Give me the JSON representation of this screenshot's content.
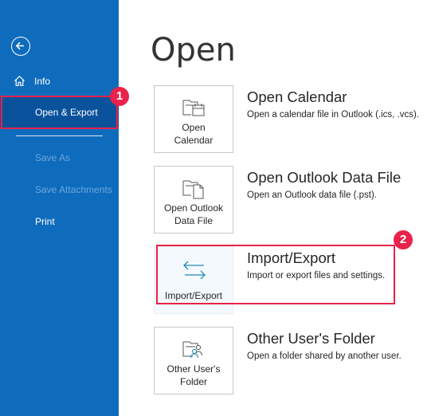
{
  "sidebar": {
    "back_icon": "back-arrow-icon",
    "items": [
      {
        "label": "Info",
        "icon": "home-icon"
      },
      {
        "label": "Open & Export"
      },
      {
        "label": "Save As"
      },
      {
        "label": "Save Attachments"
      },
      {
        "label": "Print"
      }
    ]
  },
  "main": {
    "title": "Open",
    "options": [
      {
        "tile": "Open\nCalendar",
        "title": "Open Calendar",
        "desc": "Open a calendar file in Outlook (.ics, .vcs).",
        "icon": "folder-calendar-icon"
      },
      {
        "tile": "Open Outlook\nData File",
        "title": "Open Outlook Data File",
        "desc": "Open an Outlook data file (.pst).",
        "icon": "folder-file-icon"
      },
      {
        "tile": "Import/Export",
        "title": "Import/Export",
        "desc": "Import or export files and settings.",
        "icon": "import-export-arrows-icon"
      },
      {
        "tile": "Other User's\nFolder",
        "title": "Other User's Folder",
        "desc": "Open a folder shared by another user.",
        "icon": "folder-user-icon"
      }
    ]
  },
  "annotations": {
    "badge1": "1",
    "badge2": "2",
    "color": "#e8224a"
  },
  "colors": {
    "sidebar": "#0f6cbd",
    "selected": "#0a539c"
  }
}
